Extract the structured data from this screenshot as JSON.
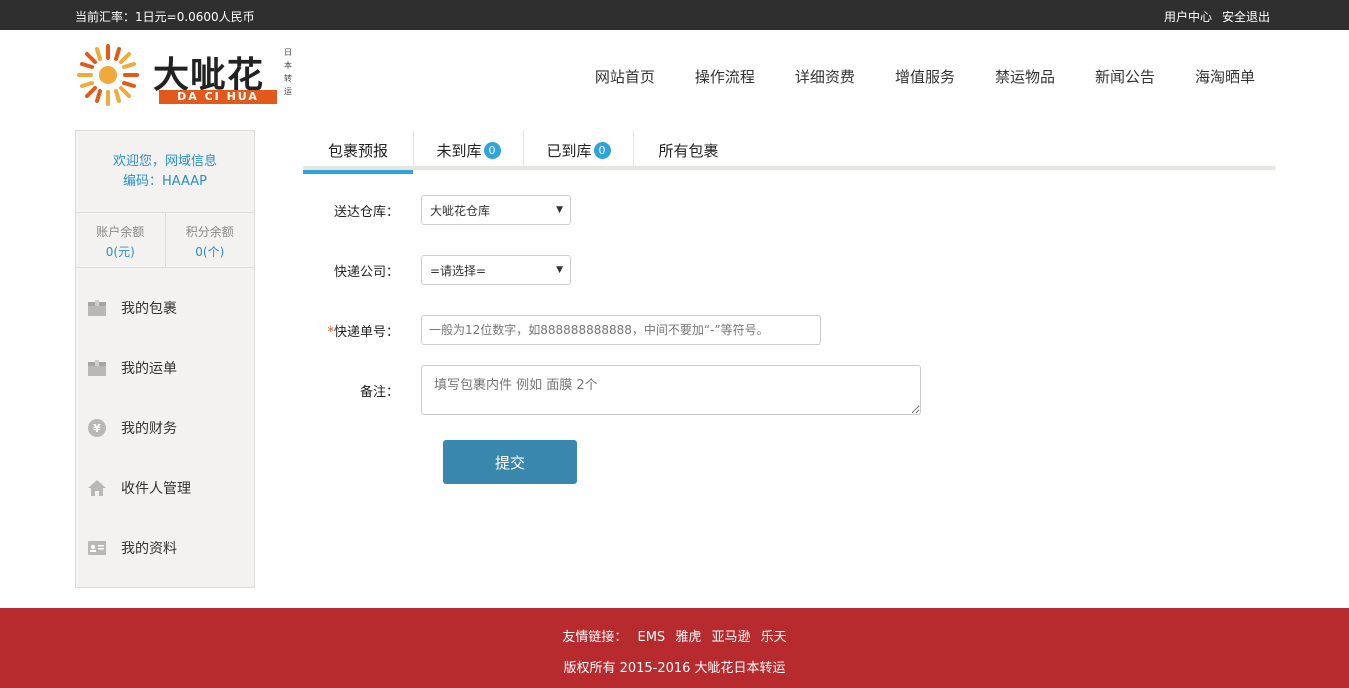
{
  "topbar": {
    "rate": "当前汇率：1日元=0.0600人民币",
    "user_center": "用户中心",
    "logout": "安全退出"
  },
  "logo": {
    "brand": "大呲花",
    "tagline": "DA CI HUA",
    "vertical": "日本转运"
  },
  "nav": [
    "网站首页",
    "操作流程",
    "详细资费",
    "增值服务",
    "禁运物品",
    "新闻公告",
    "海淘晒单"
  ],
  "sidebar": {
    "welcome": "欢迎您，网域信息",
    "code": "编码：HAAAP",
    "balance_label": "账户余额",
    "balance_value": "0(元)",
    "points_label": "积分余额",
    "points_value": "0(个)",
    "menu": [
      {
        "label": "我的包裹",
        "icon": "package-icon"
      },
      {
        "label": "我的运单",
        "icon": "waybill-icon"
      },
      {
        "label": "我的财务",
        "icon": "yen-icon"
      },
      {
        "label": "收件人管理",
        "icon": "home-icon"
      },
      {
        "label": "我的资料",
        "icon": "id-card-icon"
      }
    ]
  },
  "tabs": [
    {
      "label": "包裹预报",
      "badge": null,
      "active": true
    },
    {
      "label": "未到库",
      "badge": "0"
    },
    {
      "label": "已到库",
      "badge": "0"
    },
    {
      "label": "所有包裹",
      "badge": null
    }
  ],
  "form": {
    "warehouse_label": "送达仓库：",
    "warehouse_value": "大呲花仓库",
    "courier_label": "快递公司：",
    "courier_value": "=请选择=",
    "tracking_required_mark": "*",
    "tracking_label": "快递单号：",
    "tracking_placeholder": "一般为12位数字，如888888888888，中间不要加“-”等符号。",
    "note_label": "备注：",
    "note_placeholder": "填写包裹内件 例如 面膜 2个",
    "submit": "提交"
  },
  "footer": {
    "links_label": "友情链接：",
    "links": [
      "EMS",
      "雅虎",
      "亚马逊",
      "乐天"
    ],
    "copyright": "版权所有 2015-2016 大呲花日本转运"
  },
  "colors": {
    "topbar": "#2f2f2f",
    "accent": "#2fa3db",
    "button": "#3a87ad",
    "footer": "#b72a2d",
    "brand_orange": "#e15a1b"
  }
}
